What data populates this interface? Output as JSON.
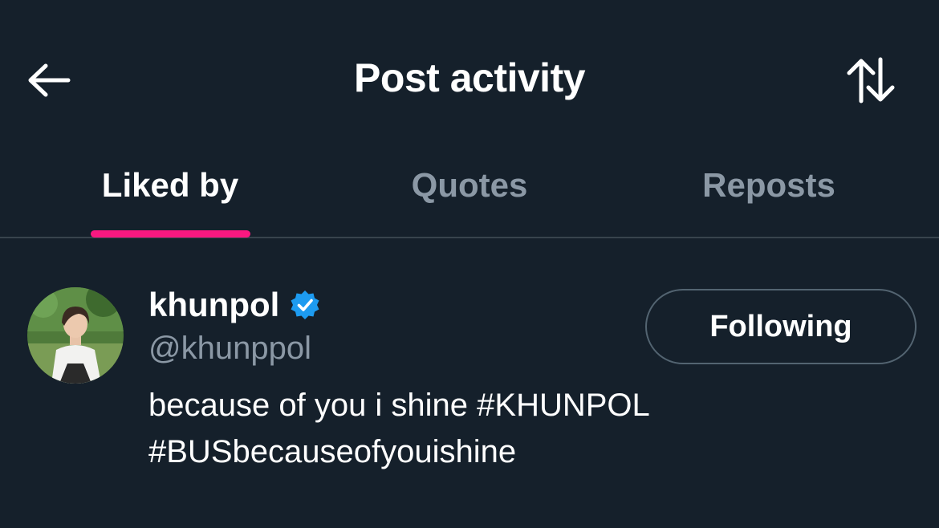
{
  "header": {
    "title": "Post activity",
    "back_icon": "arrow-left-icon",
    "sort_icon": "sort-arrows-icon"
  },
  "tabs": [
    {
      "label": "Liked by",
      "active": true
    },
    {
      "label": "Quotes",
      "active": false
    },
    {
      "label": "Reposts",
      "active": false
    }
  ],
  "user": {
    "display_name": "khunpol",
    "handle": "@khunppol",
    "verified": true,
    "bio": "because of you i shine #KHUNPOL #BUSbecauseofyouishine",
    "follow_label": "Following"
  },
  "colors": {
    "background": "#15202b",
    "accent": "#f91880",
    "verified": "#1d9bf0",
    "muted_text": "#8b98a5",
    "divider": "#38444d"
  }
}
